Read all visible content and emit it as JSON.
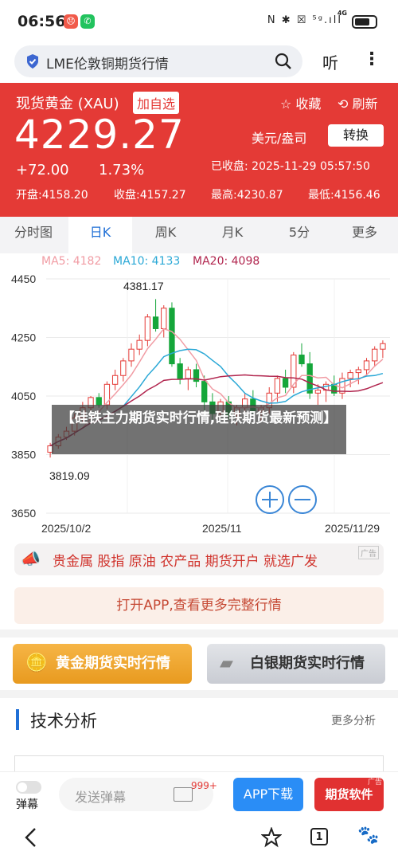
{
  "status_bar": {
    "time": "06:56",
    "badge1": "😞",
    "badge2": "✆",
    "network": "4G",
    "signal": "N ✱ ☒ ⁵ᵍ.ıll"
  },
  "search": {
    "query": "LME伦敦铜期货行情",
    "listen_label": "听"
  },
  "quote": {
    "name": "现货黄金 (XAU)",
    "add_fav": "加自选",
    "fav": "☆ 收藏",
    "refresh": "⟲ 刷新",
    "price": "4229.27",
    "unit": "美元/盎司",
    "swap": "转换",
    "change": "+72.00",
    "change_pct": "1.73%",
    "close_time": "已收盘: 2025-11-29 05:57:50",
    "open": "开盘:4158.20",
    "prev_close": "收盘:4157.27",
    "high": "最高:4230.87",
    "low": "最低:4156.46"
  },
  "tabs": [
    "分时图",
    "日K",
    "周K",
    "月K",
    "5分",
    "更多"
  ],
  "active_tab": 1,
  "chart_data": {
    "type": "candlestick",
    "ma": {
      "ma5": "MA5: 4182",
      "ma10": "MA10: 4133",
      "ma20": "MA20: 4098"
    },
    "y_ticks": [
      "4450",
      "4250",
      "4050",
      "3850",
      "3650"
    ],
    "x_ticks": [
      "2025/10/2",
      "2025/11",
      "2025/11/29"
    ],
    "ylim": [
      3650,
      4450
    ],
    "annotations": {
      "high": "4381.17",
      "low": "3819.09"
    },
    "candles": [
      [
        3858,
        3890,
        3840,
        3880
      ],
      [
        3880,
        3920,
        3870,
        3910
      ],
      [
        3910,
        3945,
        3900,
        3930
      ],
      [
        3930,
        3990,
        3915,
        3975
      ],
      [
        3975,
        4030,
        3960,
        4010
      ],
      [
        4010,
        4050,
        3990,
        4045
      ],
      [
        4045,
        4060,
        4010,
        4020
      ],
      [
        4020,
        4100,
        4005,
        4090
      ],
      [
        4090,
        4140,
        4070,
        4120
      ],
      [
        4120,
        4180,
        4100,
        4170
      ],
      [
        4170,
        4230,
        4150,
        4210
      ],
      [
        4210,
        4260,
        4190,
        4240
      ],
      [
        4240,
        4330,
        4220,
        4320
      ],
      [
        4320,
        4381,
        4270,
        4280
      ],
      [
        4280,
        4360,
        4250,
        4350
      ],
      [
        4350,
        4370,
        4150,
        4160
      ],
      [
        4160,
        4180,
        4090,
        4110
      ],
      [
        4110,
        4150,
        4070,
        4140
      ],
      [
        4140,
        4160,
        4080,
        4100
      ],
      [
        4100,
        4120,
        3990,
        4030
      ],
      [
        4030,
        4060,
        3960,
        3990
      ],
      [
        3990,
        4040,
        3980,
        4030
      ],
      [
        4030,
        4050,
        3970,
        3985
      ],
      [
        3985,
        4020,
        3950,
        4010
      ],
      [
        4010,
        4060,
        3990,
        4040
      ],
      [
        4040,
        4070,
        3990,
        4000
      ],
      [
        4000,
        4020,
        3960,
        4010
      ],
      [
        4010,
        4080,
        3990,
        4060
      ],
      [
        4060,
        4120,
        4030,
        4110
      ],
      [
        4110,
        4140,
        4060,
        4080
      ],
      [
        4080,
        4200,
        4060,
        4190
      ],
      [
        4190,
        4230,
        4150,
        4160
      ],
      [
        4160,
        4200,
        4040,
        4060
      ],
      [
        4060,
        4090,
        4020,
        4070
      ],
      [
        4070,
        4100,
        4030,
        4090
      ],
      [
        4090,
        4120,
        4050,
        4060
      ],
      [
        4060,
        4130,
        4040,
        4110
      ],
      [
        4110,
        4140,
        4080,
        4130
      ],
      [
        4130,
        4150,
        4090,
        4140
      ],
      [
        4140,
        4180,
        4120,
        4170
      ],
      [
        4170,
        4220,
        4150,
        4210
      ],
      [
        4210,
        4240,
        4180,
        4229
      ]
    ],
    "colors": {
      "up": "#e43a36",
      "down": "#15a63a",
      "ma5": "#f19ca4",
      "ma10": "#2aa8d6",
      "ma20": "#b1254e"
    }
  },
  "ad_banner": {
    "text": "贵金属 股指 原油 农产品 期货开户 就选广发",
    "tag": "广告"
  },
  "open_app": "打开APP,查看更多完整行情",
  "quick_links": {
    "gold": "黄金期货实时行情",
    "silver": "白银期货实时行情"
  },
  "tech": {
    "title": "技术分析",
    "more": "更多分析"
  },
  "comment": {
    "danmaku": "弹幕",
    "placeholder": "发送弹幕",
    "count": "999+",
    "app_download": "APP下载",
    "futures_app": "期货软件",
    "ad_tag": "广告"
  },
  "overlay": {
    "title": "【硅铁主力期货实时行情,硅铁期货最新预测】"
  },
  "nav": {
    "tab_count": "1"
  }
}
